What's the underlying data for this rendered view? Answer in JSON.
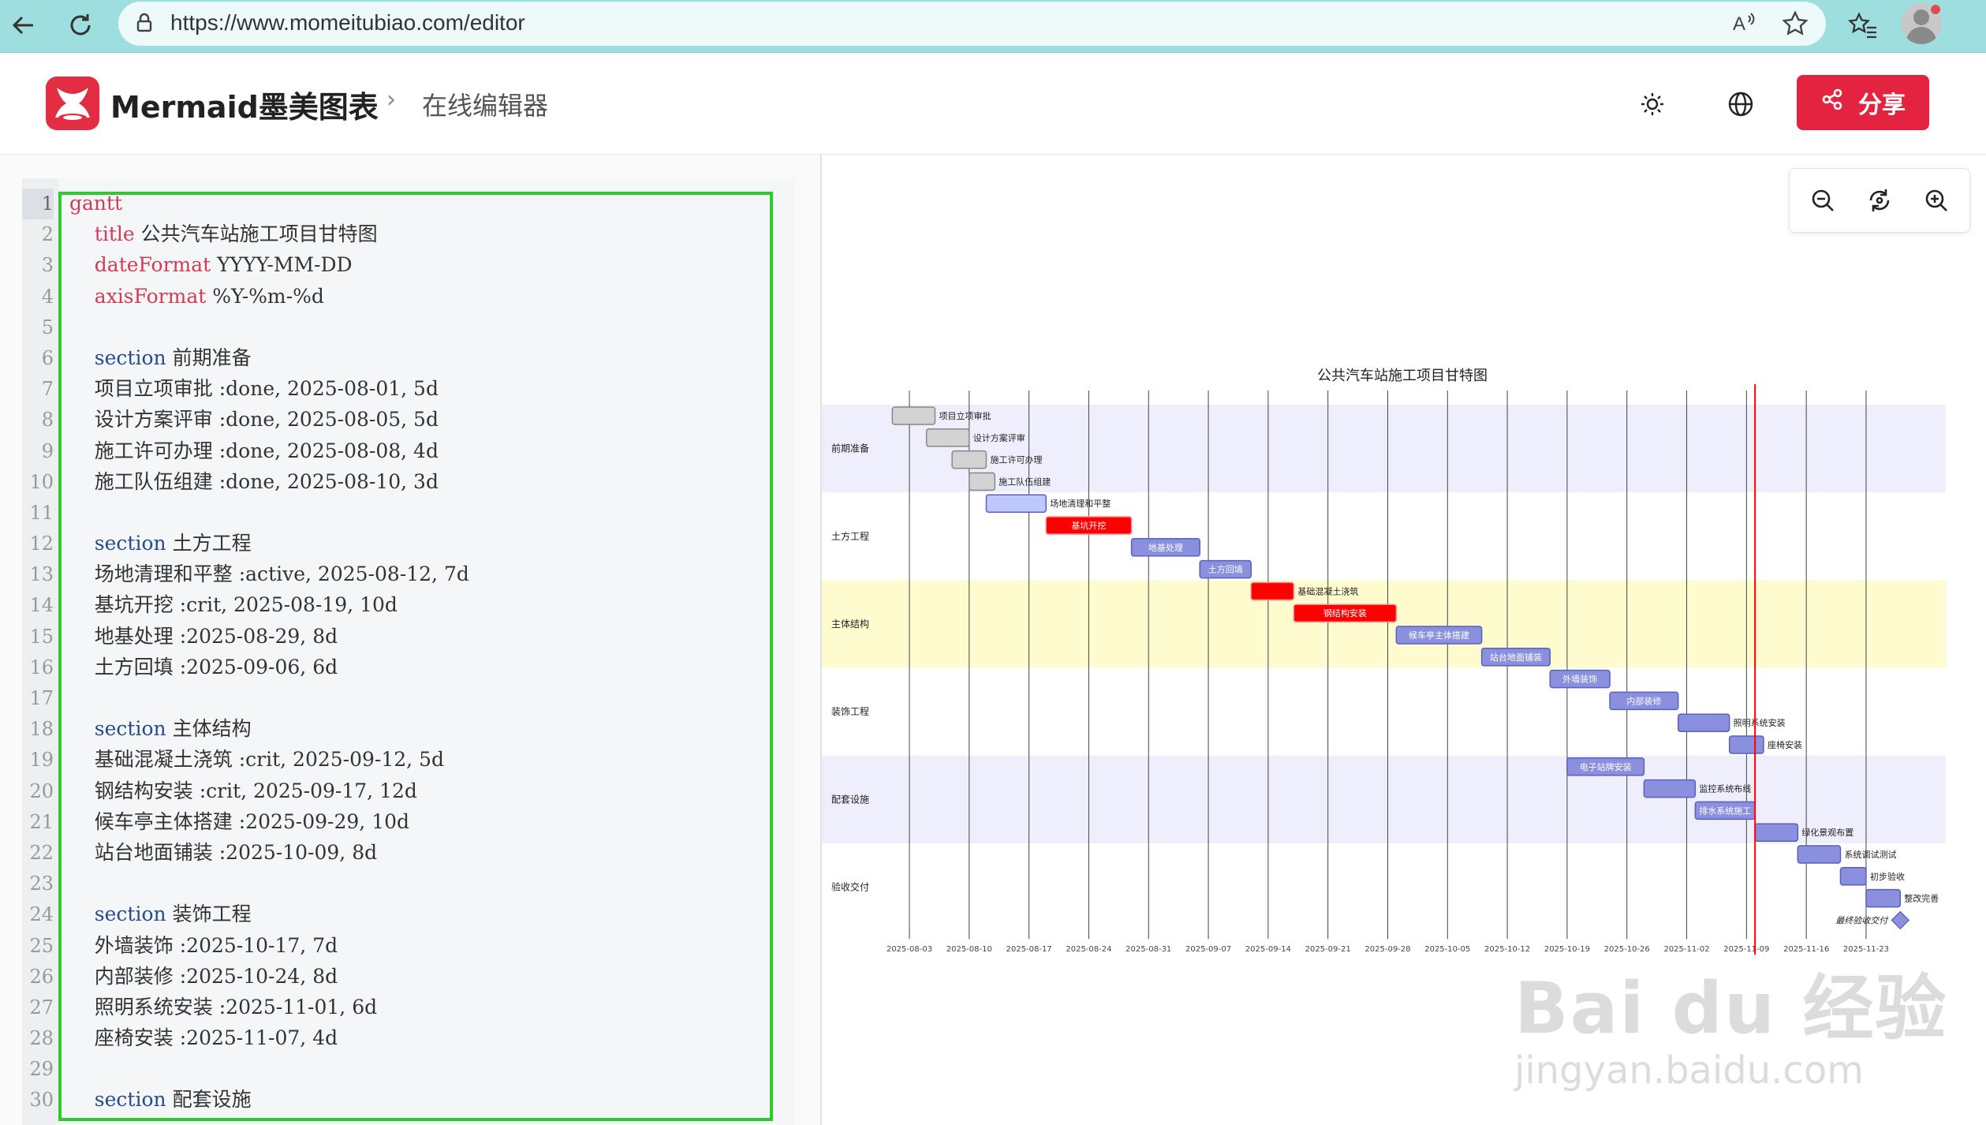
{
  "browser": {
    "url": "https://www.momeitubiao.com/editor"
  },
  "header": {
    "brand": "Mermaid墨美图表",
    "breadcrumb_sep": "›",
    "breadcrumb": "在线编辑器",
    "share_label": "分享"
  },
  "editor": {
    "lines": [
      {
        "n": "1",
        "parts": [
          [
            "kw",
            "gantt"
          ]
        ]
      },
      {
        "n": "2",
        "parts": [
          [
            "txt",
            "    "
          ],
          [
            "kw",
            "title"
          ],
          [
            "txt",
            " 公共汽车站施工项目甘特图"
          ]
        ]
      },
      {
        "n": "3",
        "parts": [
          [
            "txt",
            "    "
          ],
          [
            "kw",
            "dateFormat"
          ],
          [
            "txt",
            " YYYY-MM-DD"
          ]
        ]
      },
      {
        "n": "4",
        "parts": [
          [
            "txt",
            "    "
          ],
          [
            "kw",
            "axisFormat"
          ],
          [
            "txt",
            " %Y-%m-%d"
          ]
        ]
      },
      {
        "n": "5",
        "parts": []
      },
      {
        "n": "6",
        "parts": [
          [
            "txt",
            "    "
          ],
          [
            "sec",
            "section"
          ],
          [
            "txt",
            " 前期准备"
          ]
        ]
      },
      {
        "n": "7",
        "parts": [
          [
            "txt",
            "    项目立项审批 :done, 2025-08-01, 5d"
          ]
        ]
      },
      {
        "n": "8",
        "parts": [
          [
            "txt",
            "    设计方案评审 :done, 2025-08-05, 5d"
          ]
        ]
      },
      {
        "n": "9",
        "parts": [
          [
            "txt",
            "    施工许可办理 :done, 2025-08-08, 4d"
          ]
        ]
      },
      {
        "n": "10",
        "parts": [
          [
            "txt",
            "    施工队伍组建 :done, 2025-08-10, 3d"
          ]
        ]
      },
      {
        "n": "11",
        "parts": []
      },
      {
        "n": "12",
        "parts": [
          [
            "txt",
            "    "
          ],
          [
            "sec",
            "section"
          ],
          [
            "txt",
            " 土方工程"
          ]
        ]
      },
      {
        "n": "13",
        "parts": [
          [
            "txt",
            "    场地清理和平整 :active, 2025-08-12, 7d"
          ]
        ]
      },
      {
        "n": "14",
        "parts": [
          [
            "txt",
            "    基坑开挖 :crit, 2025-08-19, 10d"
          ]
        ]
      },
      {
        "n": "15",
        "parts": [
          [
            "txt",
            "    地基处理 :2025-08-29, 8d"
          ]
        ]
      },
      {
        "n": "16",
        "parts": [
          [
            "txt",
            "    土方回填 :2025-09-06, 6d"
          ]
        ]
      },
      {
        "n": "17",
        "parts": []
      },
      {
        "n": "18",
        "parts": [
          [
            "txt",
            "    "
          ],
          [
            "sec",
            "section"
          ],
          [
            "txt",
            " 主体结构"
          ]
        ]
      },
      {
        "n": "19",
        "parts": [
          [
            "txt",
            "    基础混凝土浇筑 :crit, 2025-09-12, 5d"
          ]
        ]
      },
      {
        "n": "20",
        "parts": [
          [
            "txt",
            "    钢结构安装 :crit, 2025-09-17, 12d"
          ]
        ]
      },
      {
        "n": "21",
        "parts": [
          [
            "txt",
            "    候车亭主体搭建 :2025-09-29, 10d"
          ]
        ]
      },
      {
        "n": "22",
        "parts": [
          [
            "txt",
            "    站台地面铺装 :2025-10-09, 8d"
          ]
        ]
      },
      {
        "n": "23",
        "parts": []
      },
      {
        "n": "24",
        "parts": [
          [
            "txt",
            "    "
          ],
          [
            "sec",
            "section"
          ],
          [
            "txt",
            " 装饰工程"
          ]
        ]
      },
      {
        "n": "25",
        "parts": [
          [
            "txt",
            "    外墙装饰 :2025-10-17, 7d"
          ]
        ]
      },
      {
        "n": "26",
        "parts": [
          [
            "txt",
            "    内部装修 :2025-10-24, 8d"
          ]
        ]
      },
      {
        "n": "27",
        "parts": [
          [
            "txt",
            "    照明系统安装 :2025-11-01, 6d"
          ]
        ]
      },
      {
        "n": "28",
        "parts": [
          [
            "txt",
            "    座椅安装 :2025-11-07, 4d"
          ]
        ]
      },
      {
        "n": "29",
        "parts": []
      },
      {
        "n": "30",
        "parts": [
          [
            "txt",
            "    "
          ],
          [
            "sec",
            "section"
          ],
          [
            "txt",
            " 配套设施"
          ]
        ]
      }
    ]
  },
  "gantt": {
    "title": "公共汽车站施工项目甘特图",
    "ticks": [
      "2025-08-03",
      "2025-08-10",
      "2025-08-17",
      "2025-08-24",
      "2025-08-31",
      "2025-09-07",
      "2025-09-14",
      "2025-09-21",
      "2025-09-28",
      "2025-10-05",
      "2025-10-12",
      "2025-10-19",
      "2025-10-26",
      "2025-11-02",
      "2025-11-09",
      "2025-11-16",
      "2025-11-23"
    ],
    "today": "2025-11-10",
    "sections": [
      {
        "name": "前期准备",
        "shade": "#eeeefc"
      },
      {
        "name": "土方工程",
        "shade": "#ffffff"
      },
      {
        "name": "主体结构",
        "shade": "#fefccf"
      },
      {
        "name": "装饰工程",
        "shade": "#ffffff"
      },
      {
        "name": "配套设施",
        "shade": "#eeeefc"
      },
      {
        "name": "验收交付",
        "shade": "#ffffff"
      }
    ],
    "tasks": [
      {
        "name": "项目立项审批",
        "status": "done",
        "start": "2025-08-01",
        "days": 5,
        "section": 0
      },
      {
        "name": "设计方案评审",
        "status": "done",
        "start": "2025-08-05",
        "days": 5,
        "section": 0
      },
      {
        "name": "施工许可办理",
        "status": "done",
        "start": "2025-08-08",
        "days": 4,
        "section": 0
      },
      {
        "name": "施工队伍组建",
        "status": "done",
        "start": "2025-08-10",
        "days": 3,
        "section": 0
      },
      {
        "name": "场地清理和平整",
        "status": "active",
        "start": "2025-08-12",
        "days": 7,
        "section": 1
      },
      {
        "name": "基坑开挖",
        "status": "crit",
        "start": "2025-08-19",
        "days": 10,
        "section": 1
      },
      {
        "name": "地基处理",
        "status": "normal",
        "start": "2025-08-29",
        "days": 8,
        "section": 1
      },
      {
        "name": "土方回填",
        "status": "normal",
        "start": "2025-09-06",
        "days": 6,
        "section": 1
      },
      {
        "name": "基础混凝土浇筑",
        "status": "crit",
        "start": "2025-09-12",
        "days": 5,
        "section": 2
      },
      {
        "name": "钢结构安装",
        "status": "crit",
        "start": "2025-09-17",
        "days": 12,
        "section": 2
      },
      {
        "name": "候车亭主体搭建",
        "status": "normal",
        "start": "2025-09-29",
        "days": 10,
        "section": 2
      },
      {
        "name": "站台地面铺装",
        "status": "normal",
        "start": "2025-10-09",
        "days": 8,
        "section": 2
      },
      {
        "name": "外墙装饰",
        "status": "normal",
        "start": "2025-10-17",
        "days": 7,
        "section": 3
      },
      {
        "name": "内部装修",
        "status": "normal",
        "start": "2025-10-24",
        "days": 8,
        "section": 3
      },
      {
        "name": "照明系统安装",
        "status": "normal",
        "start": "2025-11-01",
        "days": 6,
        "section": 3
      },
      {
        "name": "座椅安装",
        "status": "normal",
        "start": "2025-11-07",
        "days": 4,
        "section": 3
      },
      {
        "name": "电子站牌安装",
        "status": "normal",
        "start": "2025-10-19",
        "days": 9,
        "section": 4
      },
      {
        "name": "监控系统布线",
        "status": "normal",
        "start": "2025-10-28",
        "days": 6,
        "section": 4
      },
      {
        "name": "排水系统施工",
        "status": "normal",
        "start": "2025-11-03",
        "days": 7,
        "section": 4
      },
      {
        "name": "绿化景观布置",
        "status": "normal",
        "start": "2025-11-10",
        "days": 5,
        "section": 4
      },
      {
        "name": "系统调试测试",
        "status": "normal",
        "start": "2025-11-15",
        "days": 5,
        "section": 5
      },
      {
        "name": "初步验收",
        "status": "normal",
        "start": "2025-11-20",
        "days": 3,
        "section": 5
      },
      {
        "name": "整改完善",
        "status": "normal",
        "start": "2025-11-23",
        "days": 4,
        "section": 5
      },
      {
        "name": "最终验收交付",
        "status": "milestone",
        "start": "2025-11-27",
        "days": 0,
        "section": 5
      }
    ]
  },
  "colors": {
    "done": "#d3d3d3",
    "active": "#bfc7ff",
    "normal": "#8a90dd",
    "crit": "#ff0000",
    "today": "#ff0000",
    "brand": "#e3233f",
    "highlight": "#2dcb2d"
  },
  "watermark": {
    "brand": "Bai  du 经验",
    "url": "jingyan.baidu.com"
  }
}
